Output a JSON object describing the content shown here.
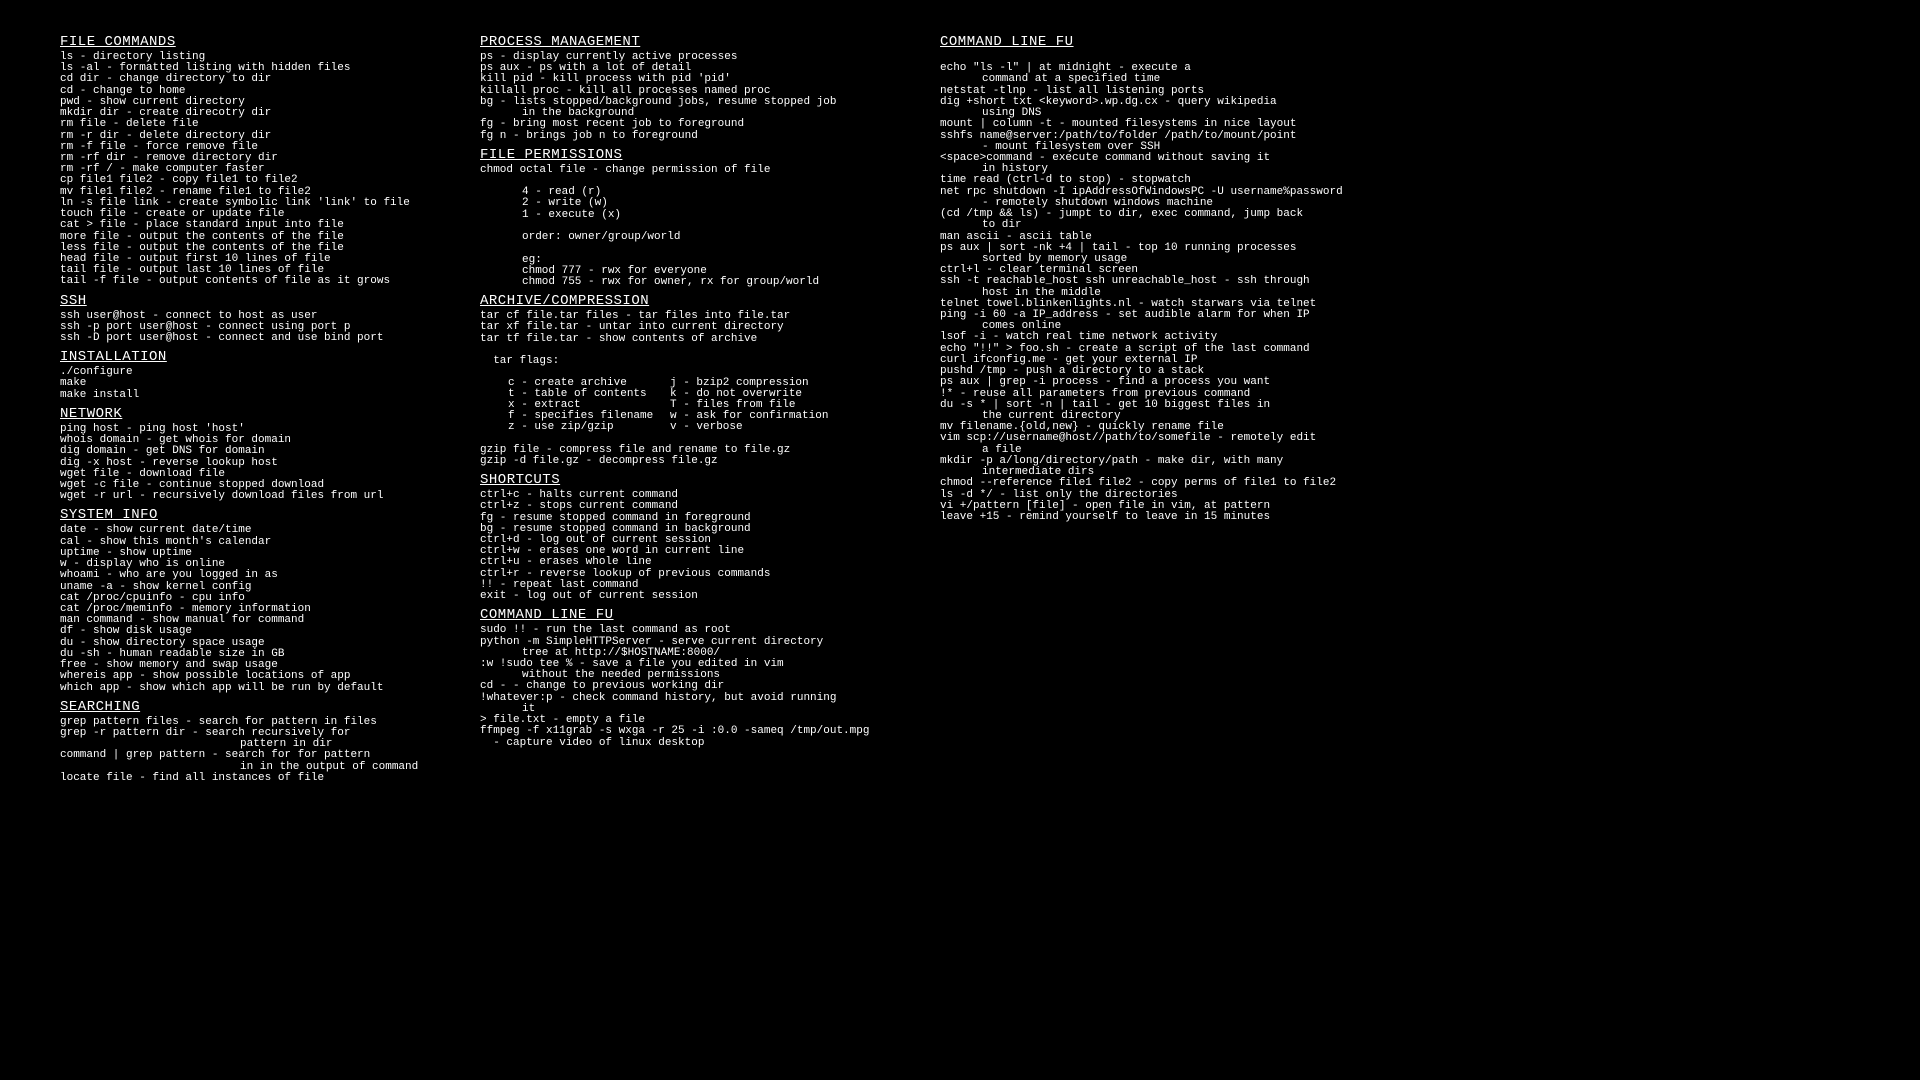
{
  "col1": {
    "file_commands": {
      "title": "FILE COMMANDS",
      "lines": [
        "ls - directory listing",
        "ls -al - formatted listing with hidden files",
        "cd dir - change directory to dir",
        "cd - change to home",
        "pwd - show current directory",
        "mkdir dir - create direcotry dir",
        "rm file - delete file",
        "rm -r dir - delete directory dir",
        "rm -f file - force remove file",
        "rm -rf dir - remove directory dir",
        "rm -rf / - make computer faster",
        "cp file1 file2 - copy file1 to file2",
        "mv file1 file2 - rename file1 to file2",
        "ln -s file link - create symbolic link 'link' to file",
        "touch file - create or update file",
        "cat > file - place standard input into file",
        "more file - output the contents of the file",
        "less file - output the contents of the file",
        "head file - output first 10 lines of file",
        "tail file - output last 10 lines of file",
        "tail -f file - output contents of file as it grows"
      ]
    },
    "ssh": {
      "title": "SSH",
      "lines": [
        "ssh user@host - connect to host as user",
        "ssh -p port user@host - connect using port p",
        "ssh -D port user@host - connect and use bind port"
      ]
    },
    "installation": {
      "title": "INSTALLATION",
      "lines": [
        "./configure",
        "make",
        "make install"
      ]
    },
    "network": {
      "title": "NETWORK",
      "lines": [
        "ping host - ping host 'host'",
        "whois domain - get whois for domain",
        "dig domain - get DNS for domain",
        "dig -x host - reverse lookup host",
        "wget file - download file",
        "wget -c file - continue stopped download",
        "wget -r url - recursively download files from url"
      ]
    },
    "system_info": {
      "title": "SYSTEM INFO",
      "lines": [
        "date - show current date/time",
        "cal - show this month's calendar",
        "uptime - show uptime",
        "w - display who is online",
        "whoami - who are you logged in as",
        "uname -a - show kernel config",
        "cat /proc/cpuinfo - cpu info",
        "cat /proc/meminfo - memory information",
        "man command - show manual for command",
        "df - show disk usage",
        "du - show directory space usage",
        "du -sh - human readable size in GB",
        "free - show memory and swap usage",
        "whereis app - show possible locations of app",
        "which app - show which app will be run by default"
      ]
    },
    "searching": {
      "title": "SEARCHING",
      "lines": [
        {
          "t": "grep pattern files - search for pattern in files"
        },
        {
          "t": "grep -r pattern dir - search recursively for"
        },
        {
          "t": "pattern in dir",
          "cls": "indent3"
        },
        {
          "t": "command | grep pattern - search for for pattern"
        },
        {
          "t": "in in the output of command",
          "cls": "indent3"
        },
        {
          "t": "locate file - find all instances of file"
        }
      ]
    }
  },
  "col2": {
    "process_management": {
      "title": "PROCESS MANAGEMENT",
      "lines": [
        {
          "t": "ps - display currently active processes"
        },
        {
          "t": "ps aux - ps with a lot of detail"
        },
        {
          "t": "kill pid - kill process with pid 'pid'"
        },
        {
          "t": "killall proc - kill all processes named proc"
        },
        {
          "t": "bg - lists stopped/background jobs, resume stopped job"
        },
        {
          "t": "in the background",
          "cls": "indent1"
        },
        {
          "t": "fg - bring most recent job to foreground"
        },
        {
          "t": "fg n - brings job n to foreground"
        }
      ]
    },
    "file_permissions": {
      "title": "FILE PERMISSIONS",
      "lines": [
        {
          "t": "chmod octal file - change permission of file"
        },
        {
          "t": " "
        },
        {
          "t": "4 - read (r)",
          "cls": "indent1"
        },
        {
          "t": "2 - write (w)",
          "cls": "indent1"
        },
        {
          "t": "1 - execute (x)",
          "cls": "indent1"
        },
        {
          "t": " "
        },
        {
          "t": "order: owner/group/world",
          "cls": "indent1"
        },
        {
          "t": " "
        },
        {
          "t": "eg:",
          "cls": "indent1"
        },
        {
          "t": "chmod 777 - rwx for everyone",
          "cls": "indent1"
        },
        {
          "t": "chmod 755 - rwx for owner, rx for group/world",
          "cls": "indent1"
        }
      ]
    },
    "archive": {
      "title": "ARCHIVE/COMPRESSION",
      "lines": [
        {
          "t": "tar cf file.tar files - tar files into file.tar"
        },
        {
          "t": "tar xf file.tar - untar into current directory"
        },
        {
          "t": "tar tf file.tar - show contents of archive"
        },
        {
          "t": " "
        },
        {
          "t": "  tar flags:"
        },
        {
          "t": " "
        }
      ],
      "flags": [
        {
          "l": "c - create archive",
          "r": "j - bzip2 compression"
        },
        {
          "l": "t - table of contents",
          "r": "k - do not overwrite"
        },
        {
          "l": "x - extract",
          "r": "T - files from file"
        },
        {
          "l": "f - specifies filename",
          "r": "w - ask for confirmation"
        },
        {
          "l": "z - use zip/gzip",
          "r": "v - verbose"
        }
      ],
      "lines2": [
        {
          "t": " "
        },
        {
          "t": "gzip file - compress file and rename to file.gz"
        },
        {
          "t": "gzip -d file.gz - decompress file.gz"
        }
      ]
    },
    "shortcuts": {
      "title": "SHORTCUTS",
      "lines": [
        "ctrl+c - halts current command",
        "ctrl+z - stops current command",
        "fg - resume stopped command in foreground",
        "bg - resume stopped command in background",
        "ctrl+d - log out of current session",
        "ctrl+w - erases one word in current line",
        "ctrl+u - erases whole line",
        "ctrl+r - reverse lookup of previous commands",
        "!! - repeat last command",
        "exit - log out of current session"
      ]
    },
    "clfu": {
      "title": "COMMAND LINE FU",
      "lines": [
        {
          "t": "sudo !! - run the last command as root"
        },
        {
          "t": "python -m SimpleHTTPServer - serve current directory"
        },
        {
          "t": "tree at http://$HOSTNAME:8000/",
          "cls": "indent1"
        },
        {
          "t": ":w !sudo tee % - save a file you edited in vim"
        },
        {
          "t": "without the needed permissions",
          "cls": "indent1"
        },
        {
          "t": "cd - - change to previous working dir"
        },
        {
          "t": "!whatever:p - check command history, but avoid running"
        },
        {
          "t": "it",
          "cls": "indent1"
        },
        {
          "t": "> file.txt - empty a file"
        },
        {
          "t": "ffmpeg -f x11grab -s wxga -r 25 -i :0.0 -sameq /tmp/out.mpg"
        },
        {
          "t": "  - capture video of linux desktop"
        }
      ]
    }
  },
  "col3": {
    "clfu": {
      "title": "COMMAND LINE FU",
      "lines": [
        {
          "t": " "
        },
        {
          "t": "echo \"ls -l\" | at midnight - execute a"
        },
        {
          "t": "command at a specified time",
          "cls": "indent1"
        },
        {
          "t": "netstat -tlnp - list all listening ports"
        },
        {
          "t": "dig +short txt <keyword>.wp.dg.cx - query wikipedia"
        },
        {
          "t": "using DNS",
          "cls": "indent1"
        },
        {
          "t": "mount | column -t - mounted filesystems in nice layout"
        },
        {
          "t": "sshfs name@server:/path/to/folder /path/to/mount/point"
        },
        {
          "t": "- mount filesystem over SSH",
          "cls": "indent1"
        },
        {
          "t": "<space>command - execute command without saving it"
        },
        {
          "t": "in history",
          "cls": "indent1"
        },
        {
          "t": "time read (ctrl-d to stop) - stopwatch"
        },
        {
          "t": "net rpc shutdown -I ipAddressOfWindowsPC -U username%password"
        },
        {
          "t": "- remotely shutdown windows machine",
          "cls": "indent1"
        },
        {
          "t": "(cd /tmp && ls) - jumpt to dir, exec command, jump back"
        },
        {
          "t": "to dir",
          "cls": "indent1"
        },
        {
          "t": "man ascii - ascii table"
        },
        {
          "t": "ps aux | sort -nk +4 | tail - top 10 running processes"
        },
        {
          "t": "sorted by memory usage",
          "cls": "indent1"
        },
        {
          "t": "ctrl+l - clear terminal screen"
        },
        {
          "t": "ssh -t reachable_host ssh unreachable_host - ssh through"
        },
        {
          "t": "host in the middle",
          "cls": "indent1"
        },
        {
          "t": "telnet towel.blinkenlights.nl - watch starwars via telnet"
        },
        {
          "t": "ping -i 60 -a IP_address - set audible alarm for when IP"
        },
        {
          "t": "comes online",
          "cls": "indent1"
        },
        {
          "t": "lsof -i - watch real time network activity"
        },
        {
          "t": "echo \"!!\" > foo.sh - create a script of the last command"
        },
        {
          "t": "curl ifconfig.me - get your external IP"
        },
        {
          "t": "pushd /tmp - push a directory to a stack"
        },
        {
          "t": "ps aux | grep -i process - find a process you want"
        },
        {
          "t": "!* - reuse all parameters from previous command"
        },
        {
          "t": "du -s * | sort -n | tail - get 10 biggest files in"
        },
        {
          "t": "the current directory",
          "cls": "indent1"
        },
        {
          "t": "mv filename.{old,new} - quickly rename file"
        },
        {
          "t": "vim scp://username@host//path/to/somefile - remotely edit"
        },
        {
          "t": "a file",
          "cls": "indent1"
        },
        {
          "t": "mkdir -p a/long/directory/path - make dir, with many"
        },
        {
          "t": "intermediate dirs",
          "cls": "indent1"
        },
        {
          "t": "chmod --reference file1 file2 - copy perms of file1 to file2"
        },
        {
          "t": "ls -d */ - list only the directories"
        },
        {
          "t": "vi +/pattern [file] - open file in vim, at pattern"
        },
        {
          "t": "leave +15 - remind yourself to leave in 15 minutes"
        }
      ]
    }
  }
}
